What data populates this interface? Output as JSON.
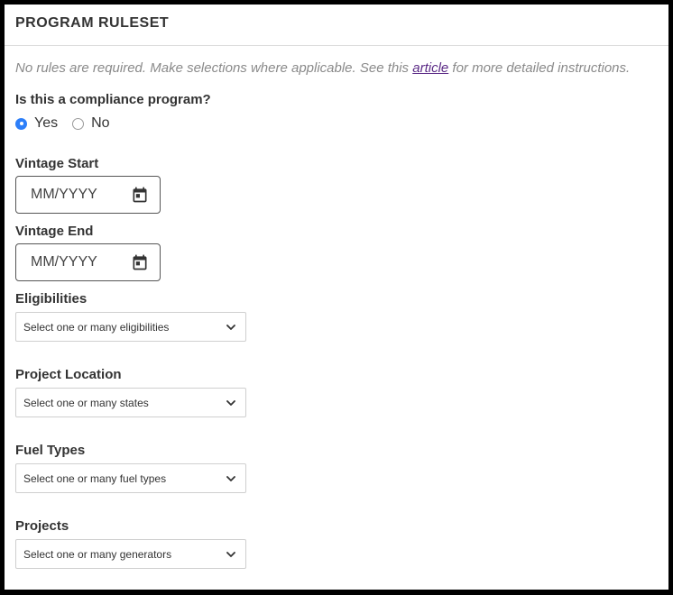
{
  "header": {
    "title": "PROGRAM RULESET"
  },
  "intro": {
    "before": "No rules are required. Make selections where applicable. See this ",
    "link": "article",
    "after": " for more detailed instructions."
  },
  "compliance": {
    "question": "Is this a compliance program?",
    "options": [
      {
        "label": "Yes",
        "checked": true
      },
      {
        "label": "No",
        "checked": false
      }
    ]
  },
  "vintage_start": {
    "label": "Vintage Start",
    "placeholder": "MM/YYYY"
  },
  "vintage_end": {
    "label": "Vintage End",
    "placeholder": "MM/YYYY"
  },
  "eligibilities": {
    "label": "Eligibilities",
    "placeholder": "Select one or many eligibilities"
  },
  "project_location": {
    "label": "Project Location",
    "placeholder": "Select one or many states"
  },
  "fuel_types": {
    "label": "Fuel Types",
    "placeholder": "Select one or many fuel types"
  },
  "projects": {
    "label": "Projects",
    "placeholder": "Select one or many generators"
  },
  "colors": {
    "accent": "#2d7ff9",
    "link": "#5b2a86"
  },
  "icons": [
    "calendar-icon",
    "chevron-down-icon"
  ]
}
